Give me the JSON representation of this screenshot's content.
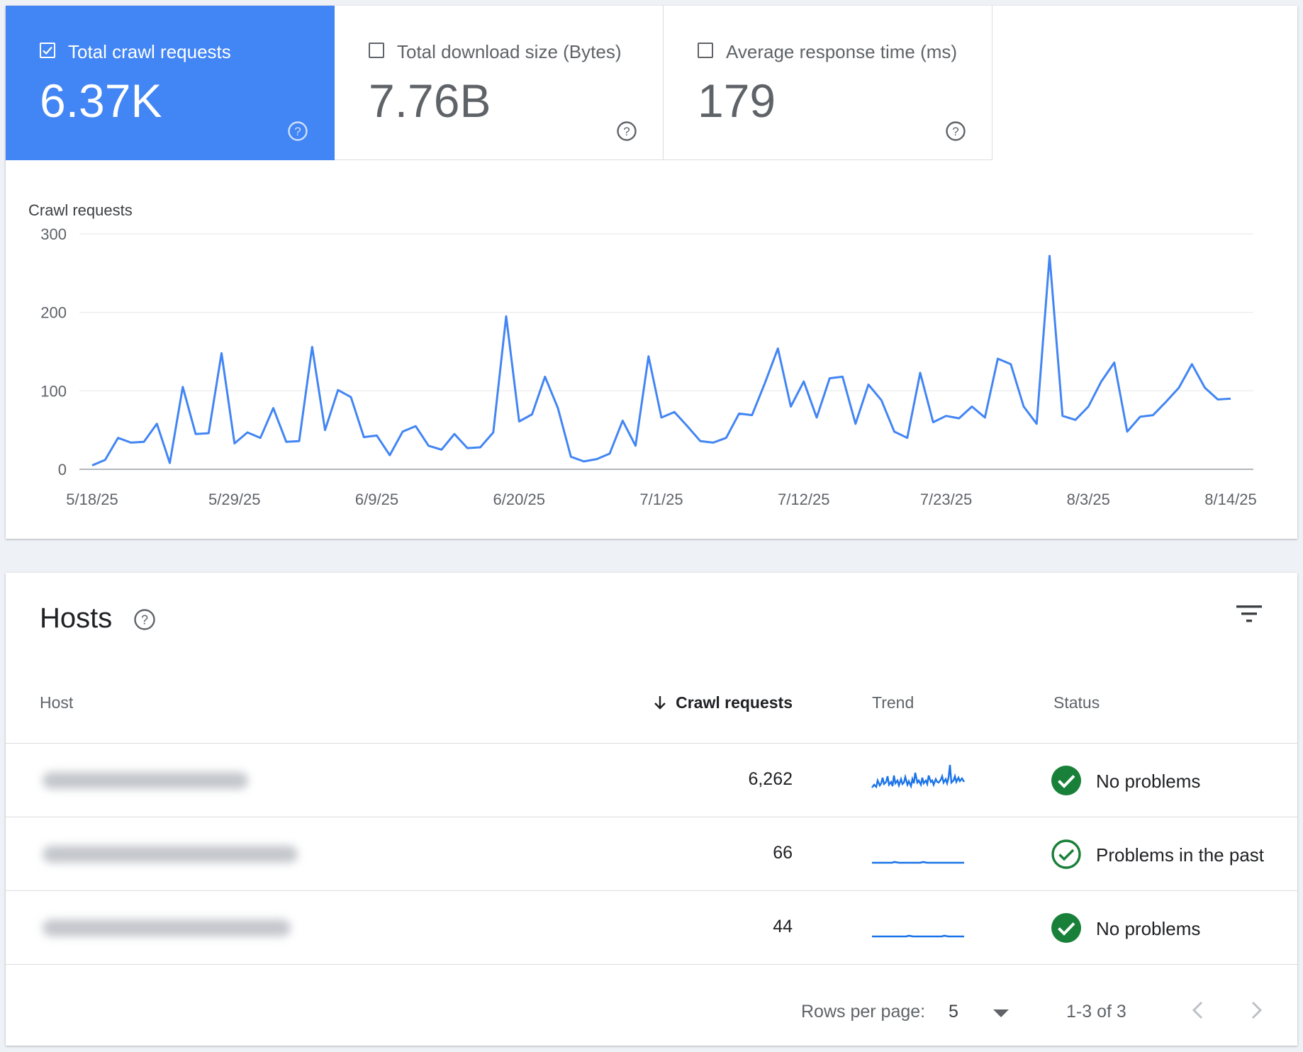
{
  "metrics": [
    {
      "label": "Total crawl requests",
      "value": "6.37K",
      "checked": true
    },
    {
      "label": "Total download size (Bytes)",
      "value": "7.76B",
      "checked": false
    },
    {
      "label": "Average response time (ms)",
      "value": "179",
      "checked": false
    }
  ],
  "chart_data": {
    "type": "line",
    "title": "Crawl requests",
    "xlabel": "",
    "ylabel": "",
    "ylim": [
      0,
      300
    ],
    "yticks": [
      "0",
      "100",
      "200",
      "300"
    ],
    "xticks": [
      "5/18/25",
      "5/29/25",
      "6/9/25",
      "6/20/25",
      "7/1/25",
      "7/12/25",
      "7/23/25",
      "8/3/25",
      "8/14/25"
    ],
    "grid": true,
    "color": "#4285f4",
    "x_start": "5/18/25",
    "x_end": "8/14/25",
    "series": [
      {
        "values": [
          5,
          12,
          40,
          34,
          35,
          58,
          8,
          105,
          45,
          46,
          148,
          33,
          47,
          40,
          78,
          35,
          36,
          156,
          50,
          101,
          92,
          41,
          43,
          18,
          48,
          55,
          30,
          25,
          45,
          27,
          28,
          47,
          195,
          61,
          70,
          118,
          78,
          16,
          10,
          13,
          20,
          62,
          30,
          144,
          66,
          73,
          55,
          36,
          34,
          40,
          71,
          69,
          110,
          154,
          80,
          112,
          66,
          116,
          118,
          58,
          108,
          88,
          48,
          40,
          123,
          60,
          68,
          65,
          80,
          66,
          141,
          134,
          80,
          58,
          272,
          68,
          63,
          80,
          112,
          136,
          48,
          67,
          69,
          86,
          104,
          134,
          104,
          89,
          90
        ]
      }
    ]
  },
  "hosts": {
    "title": "Hosts",
    "columns": {
      "host": "Host",
      "crawl_requests": "Crawl requests",
      "trend": "Trend",
      "status": "Status"
    },
    "rows": [
      {
        "crawl_requests": "6,262",
        "status": "No problems",
        "status_type": "ok"
      },
      {
        "crawl_requests": "66",
        "status": "Problems in the past",
        "status_type": "past"
      },
      {
        "crawl_requests": "44",
        "status": "No problems",
        "status_type": "ok"
      }
    ],
    "footer": {
      "rows_per_page_label": "Rows per page:",
      "rows_per_page": "5",
      "range": "1-3 of 3"
    }
  },
  "colors": {
    "accent": "#4285f4",
    "success": "#188038",
    "trend": "#1a73e8"
  }
}
